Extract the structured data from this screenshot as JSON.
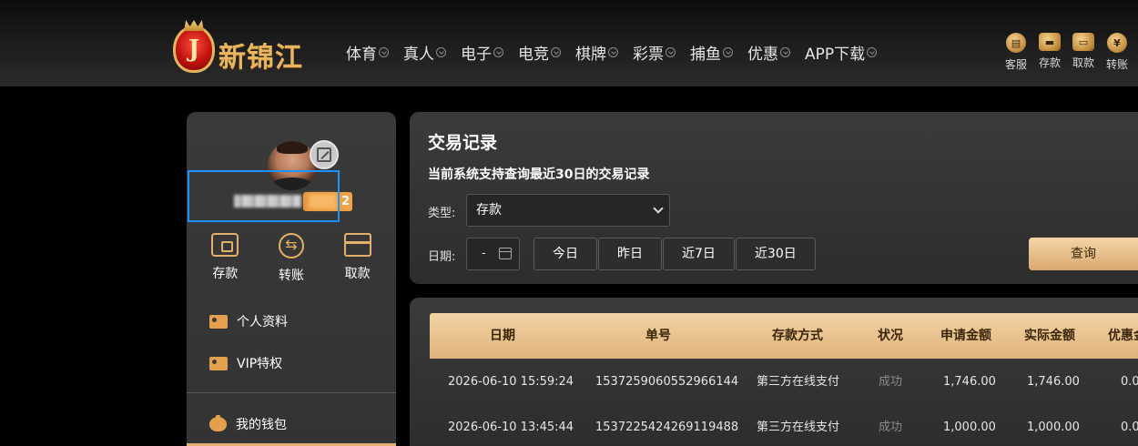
{
  "header": {
    "logo_text": "新锦江",
    "logo_letter": "J",
    "nav": [
      "体育",
      "真人",
      "电子",
      "电竞",
      "棋牌",
      "彩票",
      "捕鱼",
      "优惠",
      "APP下载"
    ],
    "quick_actions": [
      {
        "label": "客服",
        "icon": "chat-icon"
      },
      {
        "label": "存款",
        "icon": "wallet-icon"
      },
      {
        "label": "取款",
        "icon": "briefcase-icon"
      },
      {
        "label": "转账",
        "icon": "coin-icon"
      }
    ]
  },
  "sidebar": {
    "vip_level_suffix": "2",
    "actions": [
      {
        "label": "存款"
      },
      {
        "label": "转账"
      },
      {
        "label": "取款"
      }
    ],
    "menu": [
      {
        "label": "个人资料"
      },
      {
        "label": "VIP特权"
      },
      {
        "label": "我的钱包"
      }
    ]
  },
  "transactions": {
    "title": "交易记录",
    "subtitle": "当前系统支持查询最近30日的交易记录",
    "type_label": "类型:",
    "type_value": "存款",
    "date_label": "日期:",
    "date_value": "-",
    "ranges": [
      "今日",
      "昨日",
      "近7日",
      "近30日"
    ],
    "query_label": "查询"
  },
  "table": {
    "columns": [
      "日期",
      "单号",
      "存款方式",
      "状况",
      "申请金额",
      "实际金额",
      "优惠金"
    ],
    "rows": [
      [
        "2026-06-10 15:59:24",
        "1537259060552966144",
        "第三方在线支付",
        "成功",
        "1,746.00",
        "1,746.00",
        "0.0"
      ],
      [
        "2026-06-10 13:45:44",
        "1537225424269119488",
        "第三方在线支付",
        "成功",
        "1,000.00",
        "1,000.00",
        "0.0"
      ]
    ]
  },
  "colors": {
    "accent_gold": "#e2b06a",
    "table_header": "#e8c08a",
    "background": "#000000",
    "panel": "#363636"
  }
}
